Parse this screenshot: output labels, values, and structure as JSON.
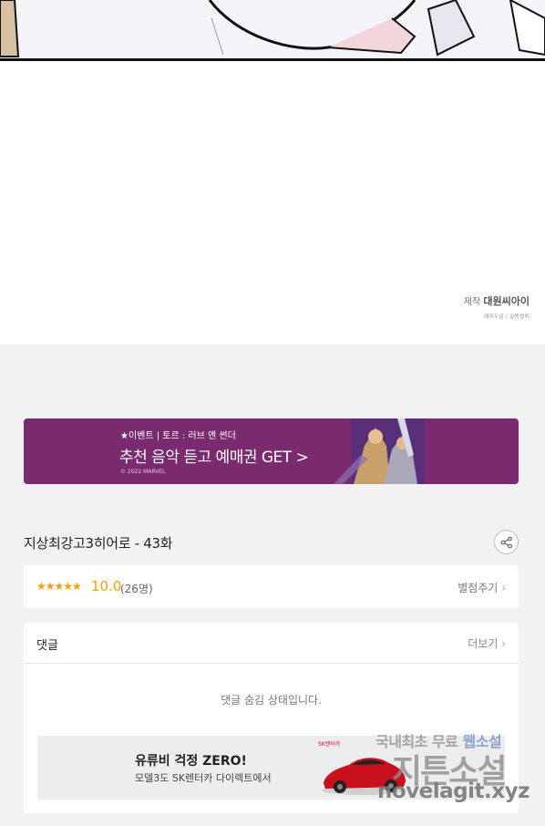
{
  "credit": {
    "label": "제작",
    "studio": "대원씨아이",
    "sub": "재미두골 / 골짱컴지"
  },
  "banner": {
    "top_text": "★이벤트 | 토르 : 러브 앤 썬더",
    "main_text": "추천 음악 듣고 예매권 GET >",
    "copyright": "© 2022 MARVEL",
    "color": "#7a2a6e"
  },
  "episode": {
    "title": "지상최강고3히어로 - 43화",
    "share_icon": "share-icon"
  },
  "rating": {
    "stars": "★★★★★",
    "score": "10.0",
    "count": "(26명)",
    "rate_button": "별점주기"
  },
  "comments": {
    "title": "댓글",
    "more": "더보기",
    "hidden_message": "댓글 숨김 상태입니다."
  },
  "ad": {
    "title": "유류비 걱정 ZERO!",
    "subtitle": "모델3도 SK렌터카 다이렉트에서",
    "brand": "SK렌터카"
  },
  "watermark": {
    "line1_a": "국내최초 무료 ",
    "line1_b": "웹소설",
    "line2": "지튼소설",
    "line3": "novelagit.xyz"
  }
}
